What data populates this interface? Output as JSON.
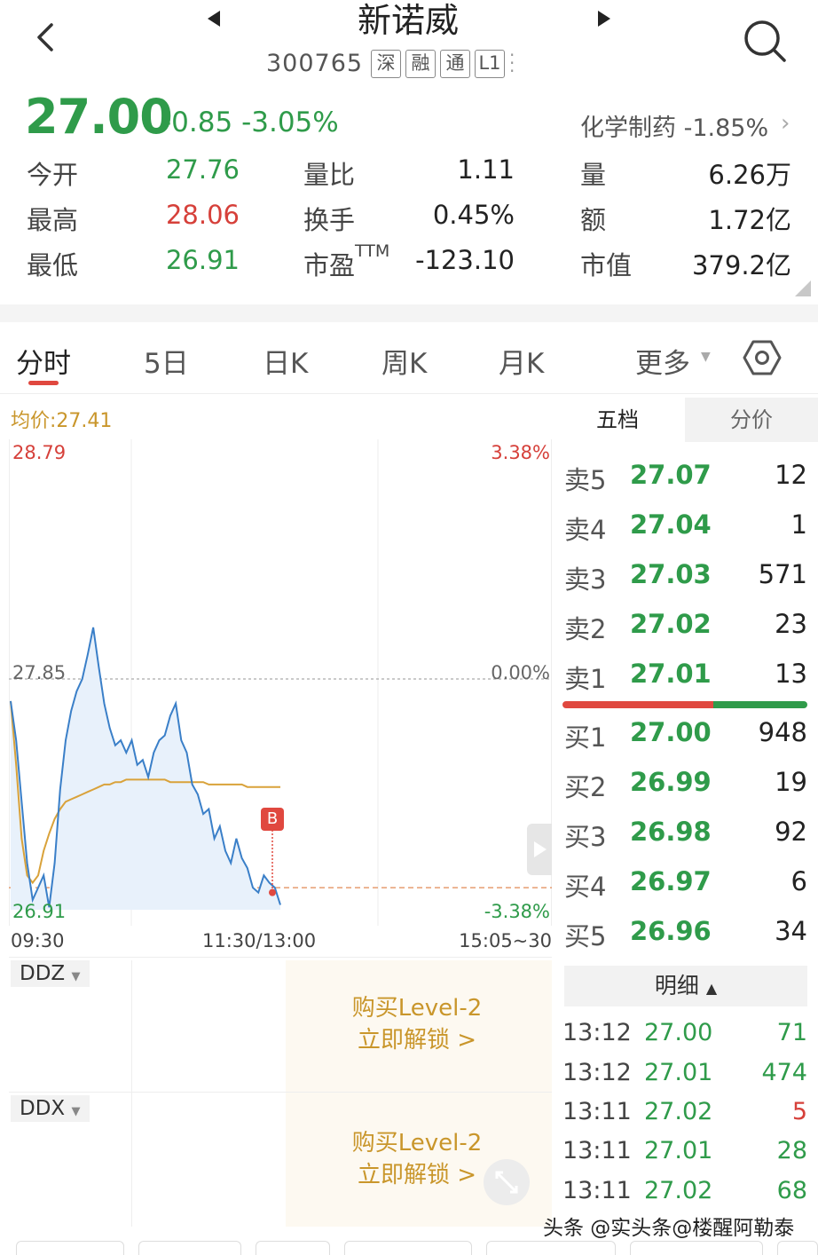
{
  "header": {
    "name": "新诺威",
    "code": "300765",
    "tags": [
      "深",
      "融",
      "通",
      "L1"
    ]
  },
  "quote": {
    "price": "27.00",
    "change": "-0.85  -3.05%",
    "sector": "化学制药  -1.85%",
    "rows": [
      {
        "l1": "今开",
        "v1": "27.76",
        "l2": "量比",
        "v2": "1.11",
        "l3": "量",
        "v3": "6.26万"
      },
      {
        "l1": "最高",
        "v1": "28.06",
        "l2": "换手",
        "v2": "0.45%",
        "l3": "额",
        "v3": "1.72亿"
      },
      {
        "l1": "最低",
        "v1": "26.91",
        "l2": "市盈",
        "l2sup": "TTM",
        "v2": "-123.10",
        "l3": "市值",
        "v3": "379.2亿"
      }
    ],
    "colors": {
      "up": "#d6403a",
      "down": "#2f9b4a"
    }
  },
  "tabs": [
    "分时",
    "5日",
    "日K",
    "周K",
    "月K",
    "更多"
  ],
  "chart": {
    "avg_label": "均价:27.41",
    "y_top": "28.79",
    "y_mid": "27.85",
    "y_bot": "26.91",
    "pct_top": "3.38%",
    "pct_mid": "0.00%",
    "pct_bot": "-3.38%",
    "t_start": "09:30",
    "t_mid": "11:30/13:00",
    "t_end": "15:05~30",
    "marker": "B"
  },
  "chart_data": {
    "type": "line",
    "title": "",
    "xlabel": "",
    "ylabel": "",
    "ylim": [
      26.91,
      28.79
    ],
    "x_ticks": [
      "09:30",
      "11:30/13:00",
      "15:05~30"
    ],
    "series": [
      {
        "values": [
          27.76,
          27.6,
          27.35,
          27.1,
          26.95,
          27.0,
          27.05,
          26.92,
          27.1,
          27.4,
          27.6,
          27.72,
          27.8,
          27.85,
          27.95,
          28.06,
          27.9,
          27.75,
          27.65,
          27.58,
          27.6,
          27.55,
          27.6,
          27.5,
          27.52,
          27.45,
          27.55,
          27.6,
          27.62,
          27.7,
          27.75,
          27.6,
          27.55,
          27.42,
          27.38,
          27.3,
          27.32,
          27.2,
          27.25,
          27.15,
          27.1,
          27.2,
          27.12,
          27.08,
          27.0,
          26.98,
          27.05,
          27.02,
          27.0,
          26.93
        ]
      },
      {
        "values": [
          27.76,
          27.5,
          27.2,
          27.05,
          27.02,
          27.05,
          27.15,
          27.22,
          27.28,
          27.32,
          27.35,
          27.36,
          27.37,
          27.38,
          27.39,
          27.4,
          27.41,
          27.42,
          27.42,
          27.43,
          27.43,
          27.44,
          27.44,
          27.44,
          27.44,
          27.44,
          27.44,
          27.44,
          27.44,
          27.43,
          27.43,
          27.43,
          27.43,
          27.43,
          27.43,
          27.43,
          27.42,
          27.42,
          27.42,
          27.42,
          27.42,
          27.42,
          27.42,
          27.41,
          27.41,
          27.41,
          27.41,
          27.41,
          27.41,
          27.41
        ]
      }
    ]
  },
  "indicators": {
    "ddz": "DDZ",
    "ddx": "DDX",
    "unlock_line1": "购买Level-2",
    "unlock_line2": "立即解锁 >"
  },
  "book": {
    "tab1": "五档",
    "tab2": "分价",
    "asks": [
      {
        "label": "卖5",
        "price": "27.07",
        "vol": "12"
      },
      {
        "label": "卖4",
        "price": "27.04",
        "vol": "1"
      },
      {
        "label": "卖3",
        "price": "27.03",
        "vol": "571"
      },
      {
        "label": "卖2",
        "price": "27.02",
        "vol": "23"
      },
      {
        "label": "卖1",
        "price": "27.01",
        "vol": "13"
      }
    ],
    "bids": [
      {
        "label": "买1",
        "price": "27.00",
        "vol": "948"
      },
      {
        "label": "买2",
        "price": "26.99",
        "vol": "19"
      },
      {
        "label": "买3",
        "price": "26.98",
        "vol": "92"
      },
      {
        "label": "买4",
        "price": "26.97",
        "vol": "6"
      },
      {
        "label": "买5",
        "price": "26.96",
        "vol": "34"
      }
    ],
    "detail_label": "明细",
    "ticks": [
      {
        "time": "13:12",
        "price": "27.00",
        "vol": "71",
        "vol_color": "#2f9b4a"
      },
      {
        "time": "13:12",
        "price": "27.01",
        "vol": "474",
        "vol_color": "#2f9b4a"
      },
      {
        "time": "13:11",
        "price": "27.02",
        "vol": "5",
        "vol_color": "#d6403a"
      },
      {
        "time": "13:11",
        "price": "27.01",
        "vol": "28",
        "vol_color": "#2f9b4a"
      },
      {
        "time": "13:11",
        "price": "27.02",
        "vol": "68",
        "vol_color": "#2f9b4a"
      }
    ]
  },
  "watermark": "头条 @实头条@楼醒阿勒泰"
}
